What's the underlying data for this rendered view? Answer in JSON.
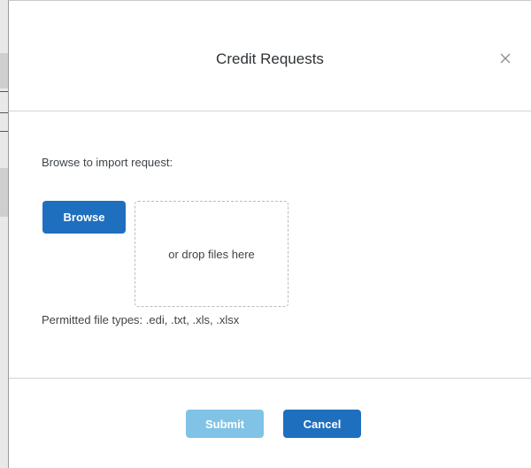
{
  "dialog": {
    "title": "Credit Requests",
    "close_icon": "close-icon"
  },
  "body": {
    "browse_label": "Browse to import request:",
    "browse_button": "Browse",
    "dropzone_text": "or drop files here",
    "permitted_types": "Permitted file types: .edi, .txt, .xls, .xlsx"
  },
  "footer": {
    "submit_button": "Submit",
    "cancel_button": "Cancel",
    "submit_disabled": true
  },
  "colors": {
    "primary": "#1f6fbf",
    "primary_disabled": "#80c3e6",
    "divider": "#cfd3d8",
    "text": "#3f4449"
  }
}
